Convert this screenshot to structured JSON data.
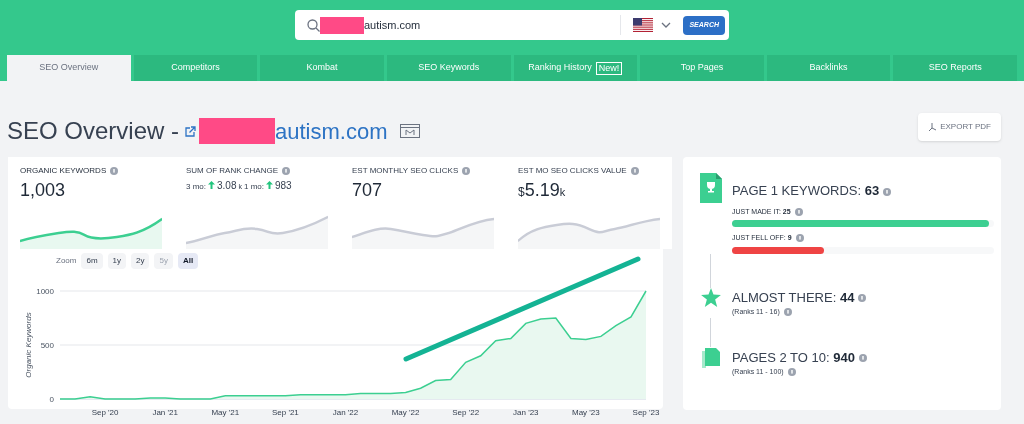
{
  "search": {
    "value": "autism.com",
    "button": "SEARCH"
  },
  "tabs": [
    {
      "label": "SEO Overview",
      "selected": true
    },
    {
      "label": "Competitors",
      "selected": false
    },
    {
      "label": "Kombat",
      "selected": false
    },
    {
      "label": "SEO Keywords",
      "selected": false
    },
    {
      "label": "Ranking History",
      "badge": "New!",
      "selected": false
    },
    {
      "label": "Top Pages",
      "selected": false
    },
    {
      "label": "Backlinks",
      "selected": false
    },
    {
      "label": "SEO Reports",
      "selected": false
    }
  ],
  "page": {
    "title": "SEO Overview -",
    "domain": "autism.com",
    "export_button": "EXPORT PDF"
  },
  "metrics": [
    {
      "kind": "number",
      "label": "ORGANIC KEYWORDS",
      "value": "1,003",
      "selected": true
    },
    {
      "kind": "changes",
      "label": "SUM OF RANK CHANGE",
      "changes": [
        {
          "period": "3 mo:",
          "value": "3.08",
          "unit": "k"
        },
        {
          "period": "1 mo:",
          "value": "983"
        }
      ],
      "selected": false
    },
    {
      "kind": "number",
      "label": "EST MONTHLY SEO CLICKS",
      "value": "707",
      "selected": false
    },
    {
      "kind": "number",
      "label": "EST MO SEO CLICKS VALUE",
      "prefix": "$",
      "value": "5.19",
      "unit": "k",
      "selected": false
    }
  ],
  "chart": {
    "zoom_label": "Zoom",
    "zoom_options": [
      {
        "label": "6m",
        "selected": false,
        "disabled": false
      },
      {
        "label": "1y",
        "selected": false,
        "disabled": false
      },
      {
        "label": "2y",
        "selected": false,
        "disabled": false
      },
      {
        "label": "5y",
        "selected": false,
        "disabled": true
      },
      {
        "label": "All",
        "selected": true,
        "disabled": false
      }
    ],
    "chart_data": {
      "type": "area",
      "ylabel": "Organic Keywords",
      "categories": [
        null,
        null,
        null,
        "Sep '20",
        null,
        null,
        null,
        "Jan '21",
        null,
        null,
        null,
        "May '21",
        null,
        null,
        null,
        "Sep '21",
        null,
        null,
        null,
        "Jan '22",
        null,
        null,
        null,
        "May '22",
        null,
        null,
        null,
        "Sep '22",
        null,
        null,
        null,
        "Jan '23",
        null,
        null,
        null,
        "May '23",
        null,
        null,
        null,
        "Sep '23"
      ],
      "series": [
        {
          "color": "#3ccf91",
          "values": [
            0,
            0,
            20,
            0,
            0,
            0,
            10,
            10,
            0,
            0,
            0,
            30,
            30,
            30,
            30,
            30,
            40,
            40,
            40,
            40,
            50,
            50,
            50,
            60,
            100,
            170,
            180,
            340,
            400,
            540,
            560,
            700,
            740,
            750,
            560,
            550,
            580,
            680,
            760,
            1000
          ]
        }
      ],
      "ylim": [
        0,
        1000
      ],
      "yticks": [
        0,
        500,
        1000
      ]
    }
  },
  "summary": [
    {
      "kind": "page1",
      "label": "PAGE 1 KEYWORDS:",
      "count": "63",
      "bars": [
        {
          "label": "JUST MADE IT:",
          "count": "25",
          "level": 0.98,
          "color": "#3ccf91"
        },
        {
          "label": "JUST FELL OFF:",
          "count": "9",
          "level": 0.35,
          "color": "#ef4444"
        }
      ]
    },
    {
      "kind": "star",
      "label": "ALMOST THERE:",
      "count": "44",
      "note": "(Ranks 11 - 16)"
    },
    {
      "kind": "pages",
      "label": "PAGES 2 TO 10:",
      "count": "940",
      "note": "(Ranks 11 - 100)"
    }
  ]
}
